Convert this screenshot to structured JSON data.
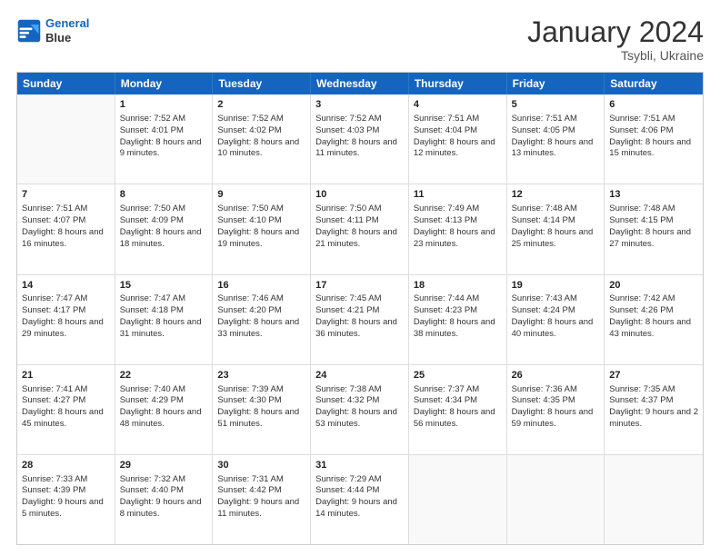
{
  "header": {
    "logo_line1": "General",
    "logo_line2": "Blue",
    "month": "January 2024",
    "location": "Tsybli, Ukraine"
  },
  "days_of_week": [
    "Sunday",
    "Monday",
    "Tuesday",
    "Wednesday",
    "Thursday",
    "Friday",
    "Saturday"
  ],
  "weeks": [
    [
      {
        "num": "",
        "sunrise": "",
        "sunset": "",
        "daylight": ""
      },
      {
        "num": "1",
        "sunrise": "Sunrise: 7:52 AM",
        "sunset": "Sunset: 4:01 PM",
        "daylight": "Daylight: 8 hours and 9 minutes."
      },
      {
        "num": "2",
        "sunrise": "Sunrise: 7:52 AM",
        "sunset": "Sunset: 4:02 PM",
        "daylight": "Daylight: 8 hours and 10 minutes."
      },
      {
        "num": "3",
        "sunrise": "Sunrise: 7:52 AM",
        "sunset": "Sunset: 4:03 PM",
        "daylight": "Daylight: 8 hours and 11 minutes."
      },
      {
        "num": "4",
        "sunrise": "Sunrise: 7:51 AM",
        "sunset": "Sunset: 4:04 PM",
        "daylight": "Daylight: 8 hours and 12 minutes."
      },
      {
        "num": "5",
        "sunrise": "Sunrise: 7:51 AM",
        "sunset": "Sunset: 4:05 PM",
        "daylight": "Daylight: 8 hours and 13 minutes."
      },
      {
        "num": "6",
        "sunrise": "Sunrise: 7:51 AM",
        "sunset": "Sunset: 4:06 PM",
        "daylight": "Daylight: 8 hours and 15 minutes."
      }
    ],
    [
      {
        "num": "7",
        "sunrise": "Sunrise: 7:51 AM",
        "sunset": "Sunset: 4:07 PM",
        "daylight": "Daylight: 8 hours and 16 minutes."
      },
      {
        "num": "8",
        "sunrise": "Sunrise: 7:50 AM",
        "sunset": "Sunset: 4:09 PM",
        "daylight": "Daylight: 8 hours and 18 minutes."
      },
      {
        "num": "9",
        "sunrise": "Sunrise: 7:50 AM",
        "sunset": "Sunset: 4:10 PM",
        "daylight": "Daylight: 8 hours and 19 minutes."
      },
      {
        "num": "10",
        "sunrise": "Sunrise: 7:50 AM",
        "sunset": "Sunset: 4:11 PM",
        "daylight": "Daylight: 8 hours and 21 minutes."
      },
      {
        "num": "11",
        "sunrise": "Sunrise: 7:49 AM",
        "sunset": "Sunset: 4:13 PM",
        "daylight": "Daylight: 8 hours and 23 minutes."
      },
      {
        "num": "12",
        "sunrise": "Sunrise: 7:48 AM",
        "sunset": "Sunset: 4:14 PM",
        "daylight": "Daylight: 8 hours and 25 minutes."
      },
      {
        "num": "13",
        "sunrise": "Sunrise: 7:48 AM",
        "sunset": "Sunset: 4:15 PM",
        "daylight": "Daylight: 8 hours and 27 minutes."
      }
    ],
    [
      {
        "num": "14",
        "sunrise": "Sunrise: 7:47 AM",
        "sunset": "Sunset: 4:17 PM",
        "daylight": "Daylight: 8 hours and 29 minutes."
      },
      {
        "num": "15",
        "sunrise": "Sunrise: 7:47 AM",
        "sunset": "Sunset: 4:18 PM",
        "daylight": "Daylight: 8 hours and 31 minutes."
      },
      {
        "num": "16",
        "sunrise": "Sunrise: 7:46 AM",
        "sunset": "Sunset: 4:20 PM",
        "daylight": "Daylight: 8 hours and 33 minutes."
      },
      {
        "num": "17",
        "sunrise": "Sunrise: 7:45 AM",
        "sunset": "Sunset: 4:21 PM",
        "daylight": "Daylight: 8 hours and 36 minutes."
      },
      {
        "num": "18",
        "sunrise": "Sunrise: 7:44 AM",
        "sunset": "Sunset: 4:23 PM",
        "daylight": "Daylight: 8 hours and 38 minutes."
      },
      {
        "num": "19",
        "sunrise": "Sunrise: 7:43 AM",
        "sunset": "Sunset: 4:24 PM",
        "daylight": "Daylight: 8 hours and 40 minutes."
      },
      {
        "num": "20",
        "sunrise": "Sunrise: 7:42 AM",
        "sunset": "Sunset: 4:26 PM",
        "daylight": "Daylight: 8 hours and 43 minutes."
      }
    ],
    [
      {
        "num": "21",
        "sunrise": "Sunrise: 7:41 AM",
        "sunset": "Sunset: 4:27 PM",
        "daylight": "Daylight: 8 hours and 45 minutes."
      },
      {
        "num": "22",
        "sunrise": "Sunrise: 7:40 AM",
        "sunset": "Sunset: 4:29 PM",
        "daylight": "Daylight: 8 hours and 48 minutes."
      },
      {
        "num": "23",
        "sunrise": "Sunrise: 7:39 AM",
        "sunset": "Sunset: 4:30 PM",
        "daylight": "Daylight: 8 hours and 51 minutes."
      },
      {
        "num": "24",
        "sunrise": "Sunrise: 7:38 AM",
        "sunset": "Sunset: 4:32 PM",
        "daylight": "Daylight: 8 hours and 53 minutes."
      },
      {
        "num": "25",
        "sunrise": "Sunrise: 7:37 AM",
        "sunset": "Sunset: 4:34 PM",
        "daylight": "Daylight: 8 hours and 56 minutes."
      },
      {
        "num": "26",
        "sunrise": "Sunrise: 7:36 AM",
        "sunset": "Sunset: 4:35 PM",
        "daylight": "Daylight: 8 hours and 59 minutes."
      },
      {
        "num": "27",
        "sunrise": "Sunrise: 7:35 AM",
        "sunset": "Sunset: 4:37 PM",
        "daylight": "Daylight: 9 hours and 2 minutes."
      }
    ],
    [
      {
        "num": "28",
        "sunrise": "Sunrise: 7:33 AM",
        "sunset": "Sunset: 4:39 PM",
        "daylight": "Daylight: 9 hours and 5 minutes."
      },
      {
        "num": "29",
        "sunrise": "Sunrise: 7:32 AM",
        "sunset": "Sunset: 4:40 PM",
        "daylight": "Daylight: 9 hours and 8 minutes."
      },
      {
        "num": "30",
        "sunrise": "Sunrise: 7:31 AM",
        "sunset": "Sunset: 4:42 PM",
        "daylight": "Daylight: 9 hours and 11 minutes."
      },
      {
        "num": "31",
        "sunrise": "Sunrise: 7:29 AM",
        "sunset": "Sunset: 4:44 PM",
        "daylight": "Daylight: 9 hours and 14 minutes."
      },
      {
        "num": "",
        "sunrise": "",
        "sunset": "",
        "daylight": ""
      },
      {
        "num": "",
        "sunrise": "",
        "sunset": "",
        "daylight": ""
      },
      {
        "num": "",
        "sunrise": "",
        "sunset": "",
        "daylight": ""
      }
    ]
  ]
}
